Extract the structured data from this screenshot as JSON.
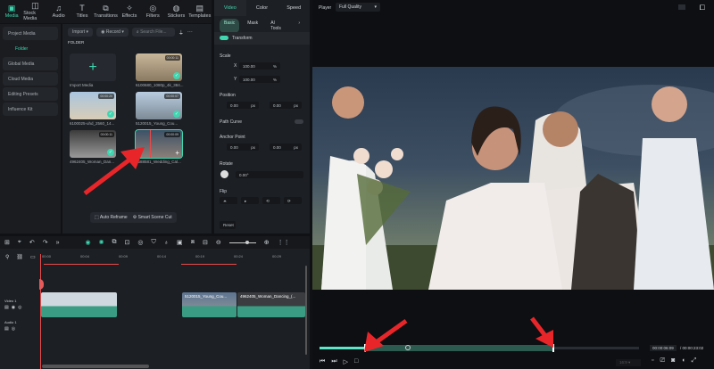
{
  "top_nav": [
    {
      "label": "Media",
      "icon": "media-icon",
      "glyph": "▣"
    },
    {
      "label": "Stock Media",
      "icon": "stock-media-icon",
      "glyph": "◫"
    },
    {
      "label": "Audio",
      "icon": "audio-icon",
      "glyph": "♫"
    },
    {
      "label": "Titles",
      "icon": "titles-icon",
      "glyph": "T"
    },
    {
      "label": "Transitions",
      "icon": "transitions-icon",
      "glyph": "⧉"
    },
    {
      "label": "Effects",
      "icon": "effects-icon",
      "glyph": "✧"
    },
    {
      "label": "Filters",
      "icon": "filters-icon",
      "glyph": "◎"
    },
    {
      "label": "Stickers",
      "icon": "stickers-icon",
      "glyph": "◍"
    },
    {
      "label": "Templates",
      "icon": "templates-icon",
      "glyph": "▤"
    }
  ],
  "sidebar": [
    "Project Media",
    "Folder",
    "Global Media",
    "Cloud Media",
    "Editing Presets",
    "Influence Kit"
  ],
  "media_toolbar": {
    "import": "Import",
    "record": "Record",
    "search_placeholder": "Search File..."
  },
  "folder_label": "FOLDER",
  "media_items": [
    {
      "name": "Import Media"
    },
    {
      "name": "6100680_1080p_4k_384...",
      "duration": "00:00:11"
    },
    {
      "name": "6100025-uhd_2560_14...",
      "duration": "00:00:20"
    },
    {
      "name": "5120015_Young_Cou...",
      "duration": "00:00:07"
    },
    {
      "name": "4962405_Woman_Dan...",
      "duration": "00:00:11"
    },
    {
      "name": "5588581_Wedding_Cal...",
      "duration": "00:00:09"
    }
  ],
  "media_actions": {
    "auto_reframe": "Auto Reframe",
    "smart_scene_cut": "Smart Scene Cut"
  },
  "props": {
    "tabs": [
      "Video",
      "Color",
      "Speed"
    ],
    "subtabs": [
      "Basic",
      "Mask",
      "AI Tools"
    ],
    "transform": "Transform",
    "scale": "Scale",
    "scale_x": "100.00",
    "scale_y": "100.00",
    "pct": "%",
    "position": "Position",
    "pos_x": "0.00",
    "pos_y": "0.00",
    "px": "px",
    "path_curve": "Path Curve",
    "anchor": "Anchor Point",
    "anc_x": "0.00",
    "anc_y": "0.00",
    "rotate": "Rotate",
    "rotate_val": "0.00°",
    "flip": "Flip",
    "reset": "Reset",
    "x": "X",
    "y": "Y"
  },
  "player": {
    "label": "Player",
    "quality": "Full Quality",
    "current": "00:00:06:09",
    "total": "/ 00:00:23:02",
    "ratio": "16:9",
    "progress": 0.14,
    "in_mark": 0.14,
    "out_mark": 0.73
  },
  "timeline": {
    "ruler": [
      "00:00",
      "00:04",
      "00:09",
      "00:14",
      "00:19",
      "00:24",
      "00:29"
    ],
    "video_track": "Video 1",
    "audio_track": "Audio 1",
    "clips": [
      "5120015_Young_Cou...",
      "4962405_Woman_Dancing_(..."
    ]
  }
}
